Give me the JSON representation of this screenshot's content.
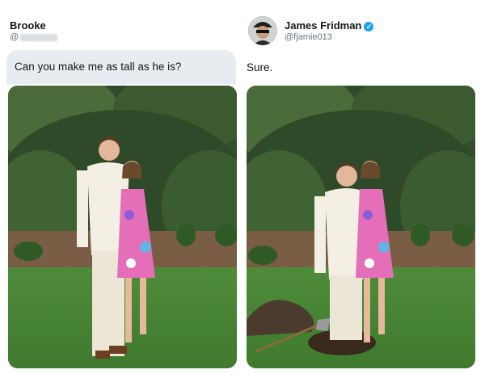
{
  "left_tweet": {
    "author_name": "Brooke",
    "handle_prefix": "@",
    "message": "Can you make me as tall as he is?"
  },
  "right_tweet": {
    "author_name": "James Fridman",
    "handle": "@fjamie013",
    "verified_icon": "verified-check-icon",
    "message": "Sure."
  },
  "colors": {
    "bubble_bg": "#e6ecf0",
    "verified": "#1da1f2",
    "name_text": "#14171a",
    "handle_text": "#657786"
  }
}
